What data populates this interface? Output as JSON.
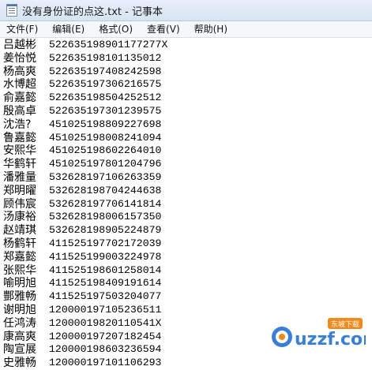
{
  "window": {
    "title": "没有身份证的点这.txt - 记事本"
  },
  "menu": [
    {
      "label": "文件(F)"
    },
    {
      "label": "编辑(E)"
    },
    {
      "label": "格式(O)"
    },
    {
      "label": "查看(V)"
    },
    {
      "label": "帮助(H)"
    }
  ],
  "content": {
    "lines": [
      {
        "name": "吕越彬",
        "id": "522635198901177277X"
      },
      {
        "name": "姜怡悦",
        "id": "522635198101135012"
      },
      {
        "name": "杨高爽",
        "id": "522635197408242598"
      },
      {
        "name": "水博超",
        "id": "522635197306216575"
      },
      {
        "name": "俞嘉懿",
        "id": "522635198504252512"
      },
      {
        "name": "殷高卓",
        "id": "522635197301239575"
      },
      {
        "name": "沈浩?",
        "id": "451025198809227698"
      },
      {
        "name": "鲁嘉懿",
        "id": "451025198008241094"
      },
      {
        "name": "安熙华",
        "id": "451025198602264010"
      },
      {
        "name": "华鹤轩",
        "id": "451025197801204796"
      },
      {
        "name": "潘雅量",
        "id": "532628197106263359"
      },
      {
        "name": "郑明曜",
        "id": "532628198704244638"
      },
      {
        "name": "顾伟宸",
        "id": "532628197706141814"
      },
      {
        "name": "汤康裕",
        "id": "532628198006157350"
      },
      {
        "name": "赵靖琪",
        "id": "532628198905224879"
      },
      {
        "name": "杨鹤轩",
        "id": "411525197702172039"
      },
      {
        "name": "郑嘉懿",
        "id": "411525199003224978"
      },
      {
        "name": "张熙华",
        "id": "411525198601258014"
      },
      {
        "name": "喻明旭",
        "id": "411525198409191614"
      },
      {
        "name": "酆雅畅",
        "id": "411525197503204077"
      },
      {
        "name": "谢明旭",
        "id": "120000197105236511"
      },
      {
        "name": "任鸿涛",
        "id": "12000019820110541X"
      },
      {
        "name": "康高爽",
        "id": "120000197207182454"
      },
      {
        "name": "陶宣展",
        "id": "120000198603236594"
      },
      {
        "name": "史雅畅",
        "id": "120000197101106293"
      }
    ]
  },
  "watermark": {
    "text": "uzzf.com",
    "badge": "东坡下载",
    "color_primary": "#3a7fd6",
    "color_accent": "#f08a1c"
  }
}
